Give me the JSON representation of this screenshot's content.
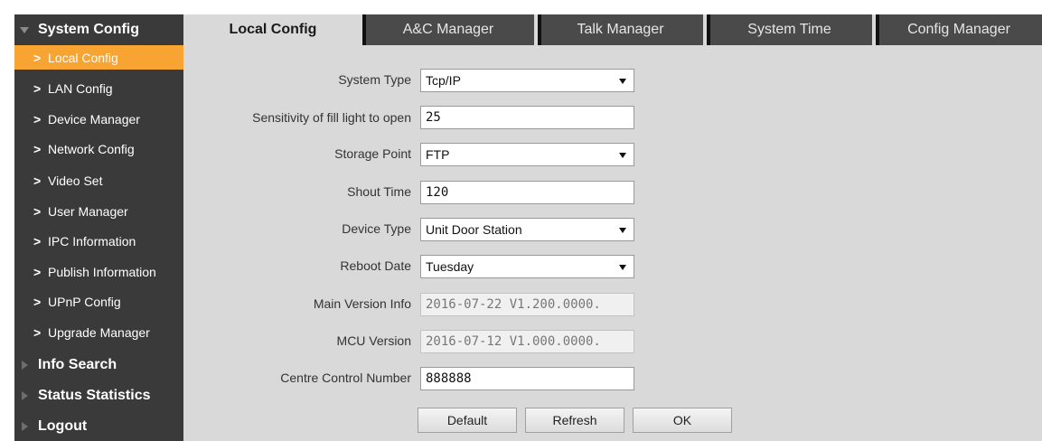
{
  "sidebar": {
    "system_config": "System Config",
    "items": [
      {
        "label": "Local Config"
      },
      {
        "label": "LAN Config"
      },
      {
        "label": "Device Manager"
      },
      {
        "label": "Network Config"
      },
      {
        "label": "Video Set"
      },
      {
        "label": "User Manager"
      },
      {
        "label": "IPC Information"
      },
      {
        "label": "Publish Information"
      },
      {
        "label": "UPnP Config"
      },
      {
        "label": "Upgrade Manager"
      }
    ],
    "chevron": ">",
    "info_search": "Info Search",
    "status_statistics": "Status Statistics",
    "logout": "Logout"
  },
  "tabs": [
    {
      "label": "Local Config"
    },
    {
      "label": "A&C Manager"
    },
    {
      "label": "Talk Manager"
    },
    {
      "label": "System Time"
    },
    {
      "label": "Config Manager"
    }
  ],
  "form": {
    "system_type": {
      "label": "System Type",
      "value": "Tcp/IP"
    },
    "fill_light": {
      "label": "Sensitivity of fill light to open",
      "value": "25"
    },
    "storage_point": {
      "label": "Storage Point",
      "value": "FTP"
    },
    "shout_time": {
      "label": "Shout Time",
      "value": "120"
    },
    "device_type": {
      "label": "Device Type",
      "value": "Unit Door Station"
    },
    "reboot_date": {
      "label": "Reboot Date",
      "value": "Tuesday"
    },
    "main_version": {
      "label": "Main Version Info",
      "value": "2016-07-22 V1.200.0000."
    },
    "mcu_version": {
      "label": "MCU Version",
      "value": "2016-07-12 V1.000.0000."
    },
    "centre_control": {
      "label": "Centre Control Number",
      "value": "888888"
    }
  },
  "buttons": {
    "default": "Default",
    "refresh": "Refresh",
    "ok": "OK"
  },
  "colors": {
    "sidebar_bg": "#3a3a3a",
    "active_item": "#f7a433",
    "tab_bg": "#4a4a4a",
    "content_bg": "#d9d9d9"
  }
}
